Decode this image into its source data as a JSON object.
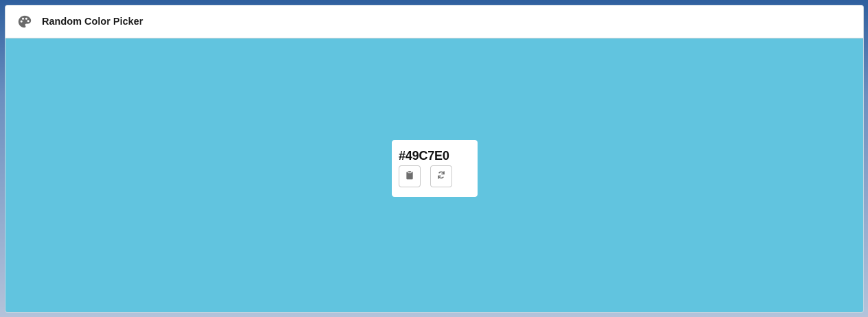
{
  "header": {
    "title": "Random Color Picker",
    "icon": "palette-icon"
  },
  "picker": {
    "color_hex": "#49C7E0",
    "background_color": "#61C4DF",
    "copy_icon": "clipboard-icon",
    "refresh_icon": "refresh-icon"
  }
}
